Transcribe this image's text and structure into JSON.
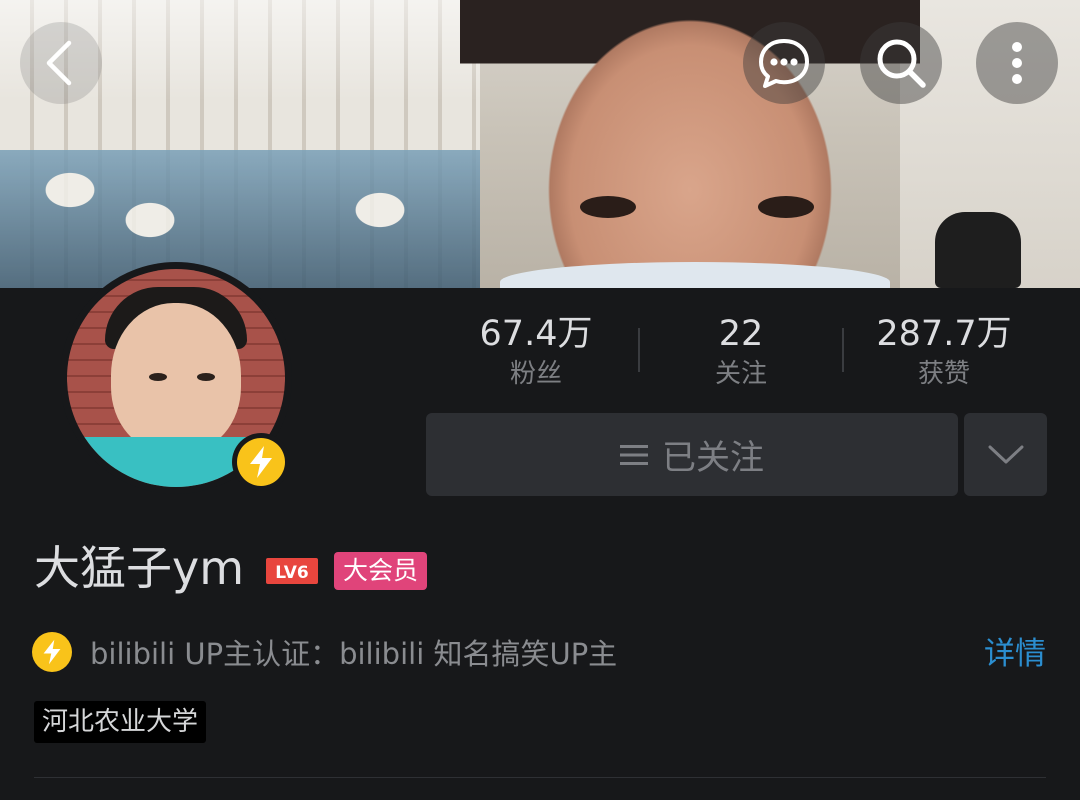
{
  "header": {
    "back_icon": "chevron-left-icon",
    "chat_icon": "chat-bubble-icon",
    "search_icon": "search-icon",
    "more_icon": "more-vertical-icon"
  },
  "profile": {
    "name": "大猛子ym",
    "level_badge": "LV6",
    "vip_badge": "大会员",
    "verify_icon": "lightning-icon"
  },
  "stats": [
    {
      "value": "67.4万",
      "label": "粉丝"
    },
    {
      "value": "22",
      "label": "关注"
    },
    {
      "value": "287.7万",
      "label": "获赞"
    }
  ],
  "follow": {
    "label": "已关注",
    "menu_icon": "hamburger-icon",
    "dropdown_icon": "chevron-down-icon"
  },
  "verification": {
    "text": "bilibili UP主认证：bilibili 知名搞笑UP主",
    "detail_link": "详情"
  },
  "tags": {
    "school": "河北农业大学"
  },
  "colors": {
    "background": "#17181a",
    "accent_link": "#2b8ed0",
    "vip_pink": "#e0447a",
    "verify_yellow": "#f9c31a",
    "level_red": "#e8463e"
  }
}
